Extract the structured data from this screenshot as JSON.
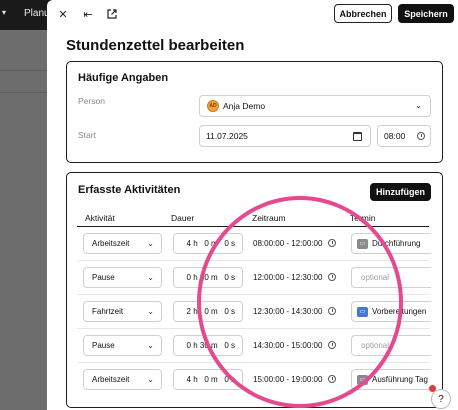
{
  "background": {
    "tab_label": "Planun"
  },
  "toolbar": {
    "close_icon": "close-icon",
    "collapse_icon": "collapse-arrow-icon",
    "open_external_icon": "external-link-icon",
    "cancel_label": "Abbrechen",
    "save_label": "Speichern"
  },
  "page_title": "Stundenzettel bearbeiten",
  "frequent": {
    "title": "Häufige Angaben",
    "person_label": "Person",
    "person_initials": "AD",
    "person_value": "Anja Demo",
    "start_label": "Start",
    "start_date": "11.07.2025",
    "start_time": "08:00"
  },
  "activities": {
    "title": "Erfasste Aktivitäten",
    "add_label": "Hinzufügen",
    "columns": {
      "activity": "Aktivität",
      "duration": "Dauer",
      "timespan": "Zeitraum",
      "appointment": "Termin"
    },
    "rows": [
      {
        "activity": "Arbeitszeit",
        "duration": "4 h   0 m   0 s",
        "timespan": "08:00:00 - 12:00:00",
        "appointment": "Durchführung",
        "appointment_icon_color": "#8a8a8a"
      },
      {
        "activity": "Pause",
        "duration": "0 h 30 m   0 s",
        "timespan": "12:00:00 - 12:30:00",
        "appointment": "optional",
        "appointment_icon_color": ""
      },
      {
        "activity": "Fahrtzeit",
        "duration": "2 h   0 m   0 s",
        "timespan": "12:30:00 - 14:30:00",
        "appointment": "Vorbereitungen",
        "appointment_icon_color": "#4a78d8"
      },
      {
        "activity": "Pause",
        "duration": "0 h 30 m   0 s",
        "timespan": "14:30:00 - 15:00:00",
        "appointment": "optional",
        "appointment_icon_color": ""
      },
      {
        "activity": "Arbeitszeit",
        "duration": "4 h   0 m   0 s",
        "timespan": "15:00:00 - 19:00:00",
        "appointment": "Ausführung Tag",
        "appointment_icon_color": "#8a8a8a"
      }
    ]
  },
  "help": {
    "label": "?"
  },
  "colors": {
    "annotation_circle": "#e54a8e",
    "primary_button": "#111111",
    "background_overlay": "#6d6d6d"
  }
}
